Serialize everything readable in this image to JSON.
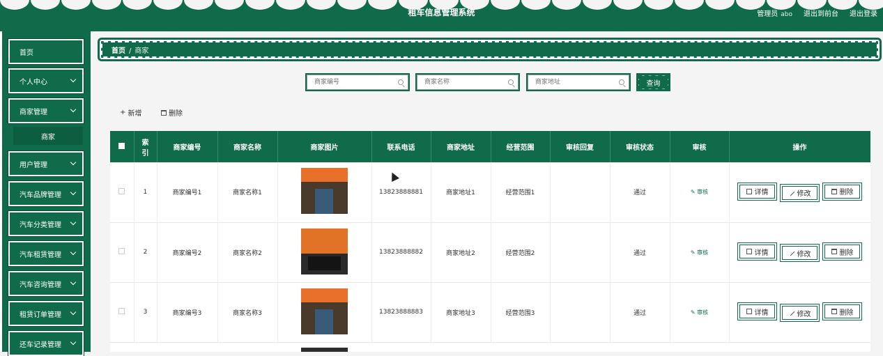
{
  "header": {
    "title": "租车信息管理系统",
    "user_label": "管理员",
    "user_name": "abo",
    "back_link": "退出到前台",
    "logout_link": "退出登录"
  },
  "sidebar": {
    "items": [
      {
        "label": "首页",
        "has_chevron": false
      },
      {
        "label": "个人中心",
        "has_chevron": true
      },
      {
        "label": "商家管理",
        "has_chevron": true
      },
      {
        "label": "用户管理",
        "has_chevron": true
      },
      {
        "label": "汽车品牌管理",
        "has_chevron": true
      },
      {
        "label": "汽车分类管理",
        "has_chevron": true
      },
      {
        "label": "汽车租赁管理",
        "has_chevron": true
      },
      {
        "label": "汽车咨询管理",
        "has_chevron": true
      },
      {
        "label": "租赁订单管理",
        "has_chevron": true
      },
      {
        "label": "还车记录管理",
        "has_chevron": true
      }
    ],
    "submenu_label": "商家"
  },
  "breadcrumb": {
    "home": "首页",
    "separator": "/",
    "current": "商家"
  },
  "search": {
    "fields": [
      {
        "placeholder": "商家编号"
      },
      {
        "placeholder": "商家名称"
      },
      {
        "placeholder": "商家地址"
      }
    ],
    "query_label": "查询"
  },
  "actions": {
    "add_label": "新增",
    "delete_label": "删除"
  },
  "table": {
    "headers": [
      "索引",
      "商家编号",
      "商家名称",
      "商家图片",
      "联系电话",
      "商家地址",
      "经营范围",
      "审核回复",
      "审核状态",
      "审核",
      "操作"
    ],
    "index_header_line1": "索",
    "index_header_line2": "引",
    "audit_link": "审核",
    "op_detail": "详情",
    "op_edit": "修改",
    "op_delete": "删除",
    "rows": [
      {
        "index": "1",
        "code": "商家编号1",
        "name": "商家名称1",
        "phone": "13823888881",
        "address": "商家地址1",
        "scope": "经营范围1",
        "reply": "",
        "status": "通过"
      },
      {
        "index": "2",
        "code": "商家编号2",
        "name": "商家名称2",
        "phone": "13823888882",
        "address": "商家地址2",
        "scope": "经营范围2",
        "reply": "",
        "status": "通过"
      },
      {
        "index": "3",
        "code": "商家编号3",
        "name": "商家名称3",
        "phone": "13823888883",
        "address": "商家地址3",
        "scope": "经营范围3",
        "reply": "",
        "status": "通过"
      }
    ]
  },
  "colors": {
    "primary": "#0f6b4a",
    "background": "#f4f4f4"
  }
}
